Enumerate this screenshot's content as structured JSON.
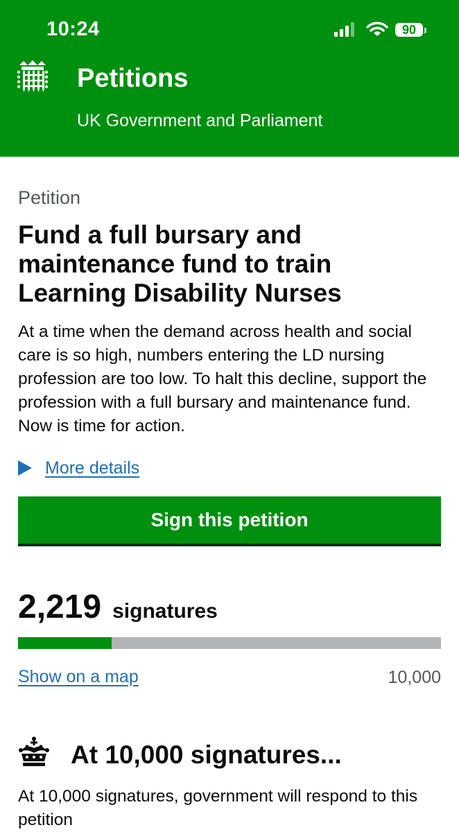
{
  "status_bar": {
    "time": "10:24",
    "battery": "90",
    "icons": [
      "cellular-signal-icon",
      "wifi-icon",
      "battery-icon"
    ]
  },
  "header": {
    "logo_icon": "portcullis-icon",
    "title": "Petitions",
    "subtitle": "UK Government and Parliament"
  },
  "petition": {
    "caption": "Petition",
    "title": "Fund a full bursary and maintenance fund to train Learning Disability Nurses",
    "description": "At a time when the demand across health and social care is so high, numbers entering the LD nursing profession are too low. To halt this decline, support the profession with a full bursary and maintenance fund. Now is time for action.",
    "more_details_label": "More details",
    "sign_button_label": "Sign this petition"
  },
  "signatures": {
    "count": "2,219",
    "label": "signatures",
    "threshold": "10,000",
    "progress_fraction": 0.2219,
    "map_link_label": "Show on a map"
  },
  "milestone": {
    "icon": "crown-icon",
    "heading": "At 10,000 signatures...",
    "text": "At 10,000 signatures, government will respond to this petition"
  },
  "colors": {
    "brand_green": "#00900f",
    "link_blue": "#1d70b8",
    "progress_track": "#b1b4b6",
    "secondary_text": "#505a5f"
  }
}
